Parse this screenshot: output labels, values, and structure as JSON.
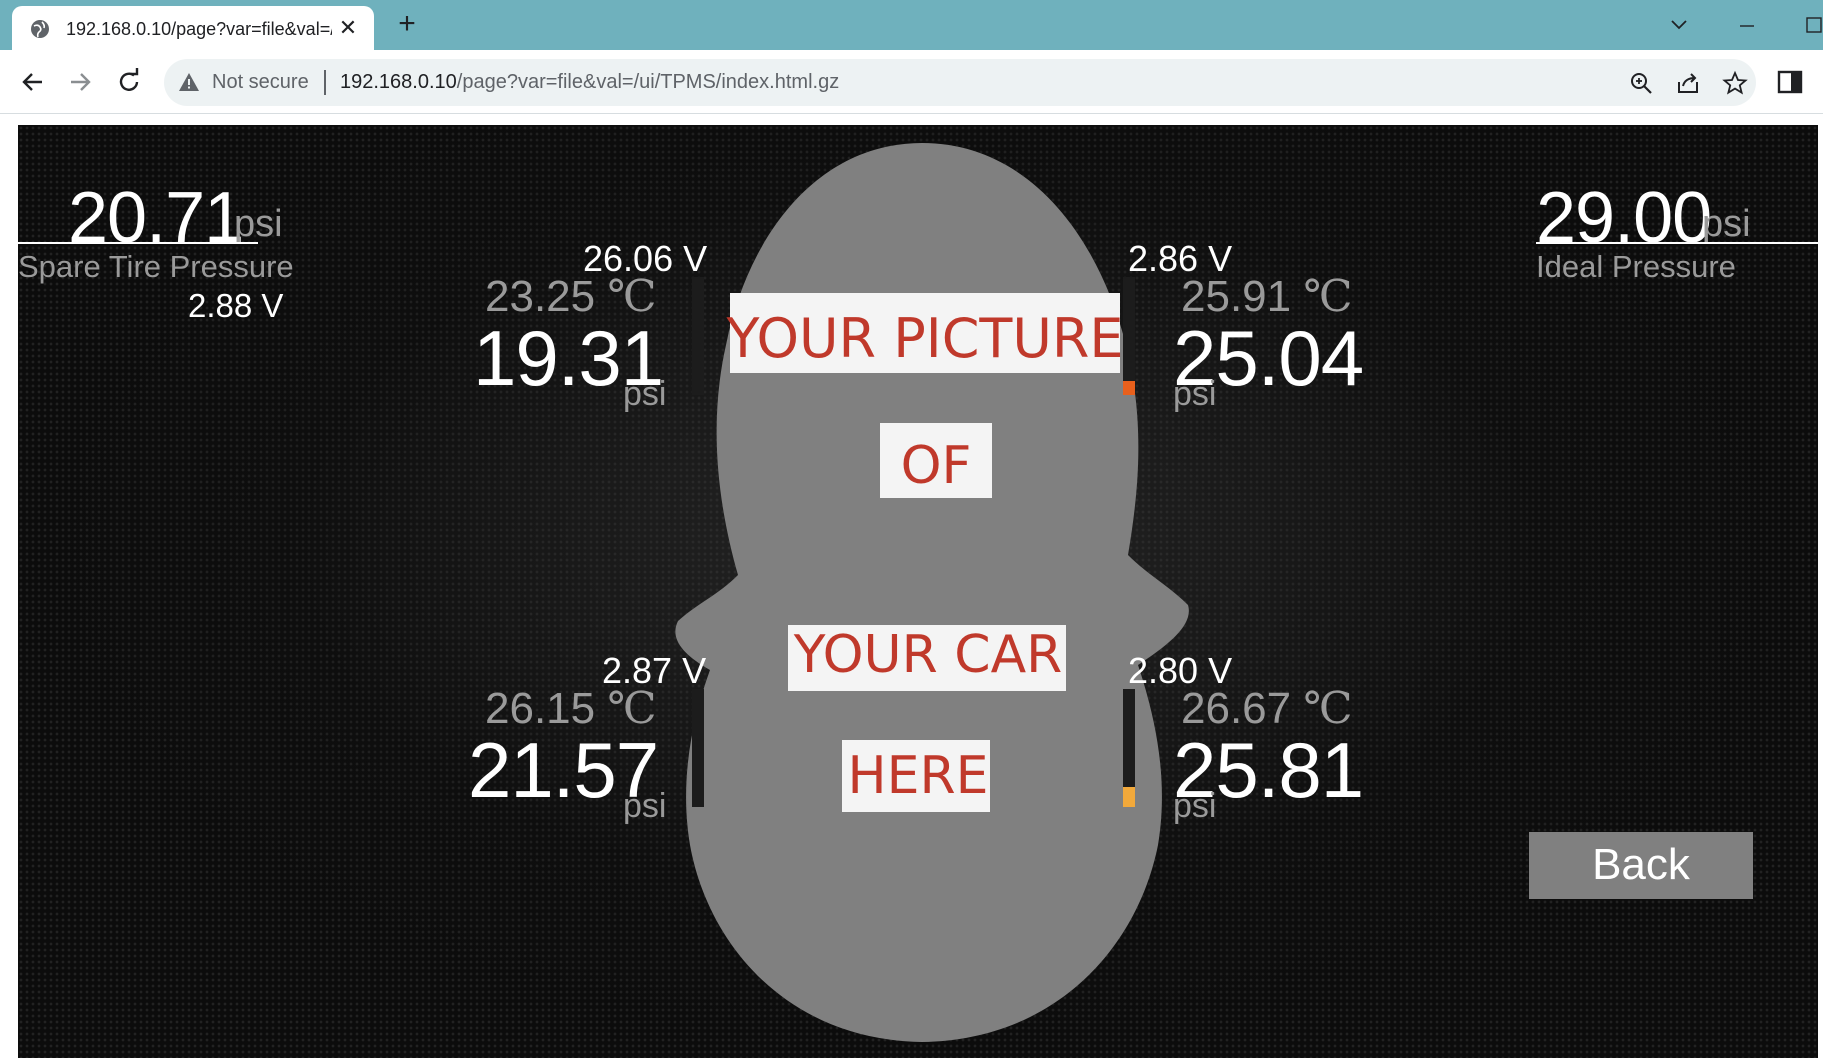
{
  "browser": {
    "tab_title": "192.168.0.10/page?var=file&val=/ui/TPMS/index.html.gz",
    "not_secure": "Not secure",
    "url_host": "192.168.0.10",
    "url_path": "/page?var=file&val=/ui/TPMS/index.html.gz"
  },
  "colors": {
    "tab_strip": "#6fb1bd",
    "background": "#0b0b0b",
    "primary_text": "#ffffff",
    "secondary_text": "#9a9a9a",
    "car_silhouette": "#808080",
    "placeholder_text": "#c0392b",
    "bar_high": "#e8601c",
    "bar_low": "#f2a93b",
    "back_button": "#808080"
  },
  "spare": {
    "pressure": "20.71",
    "unit": "psi",
    "label": "Spare Tire Pressure",
    "voltage": "2.88",
    "voltage_unit": "V"
  },
  "ideal": {
    "pressure": "29.00",
    "unit": "psi",
    "label": "Ideal Pressure"
  },
  "tires": {
    "front_left": {
      "voltage": "26.06 V",
      "temp": "23.25",
      "temp_unit": "℃",
      "pressure": "19.31",
      "unit": "psi"
    },
    "front_right": {
      "voltage": "2.86 V",
      "temp": "25.91",
      "temp_unit": "℃",
      "pressure": "25.04",
      "unit": "psi",
      "bar_level": 0.12
    },
    "rear_left": {
      "voltage": "2.87 V",
      "temp": "26.15",
      "temp_unit": "℃",
      "pressure": "21.57",
      "unit": "psi"
    },
    "rear_right": {
      "voltage": "2.80 V",
      "temp": "26.67",
      "temp_unit": "℃",
      "pressure": "25.81",
      "unit": "psi",
      "bar_level": 0.17
    }
  },
  "car_placeholder": {
    "line1": "YOUR PICTURE",
    "line2": "OF",
    "line3": "YOUR CAR",
    "line4": "HERE"
  },
  "back_label": "Back",
  "icons": [
    "globe-icon",
    "close-icon",
    "plus-icon",
    "chevron-down-icon",
    "minimize-icon",
    "maximize-icon",
    "back-arrow-icon",
    "forward-arrow-icon",
    "reload-icon",
    "warning-icon",
    "zoom-icon",
    "share-icon",
    "star-icon",
    "side-panel-icon"
  ]
}
